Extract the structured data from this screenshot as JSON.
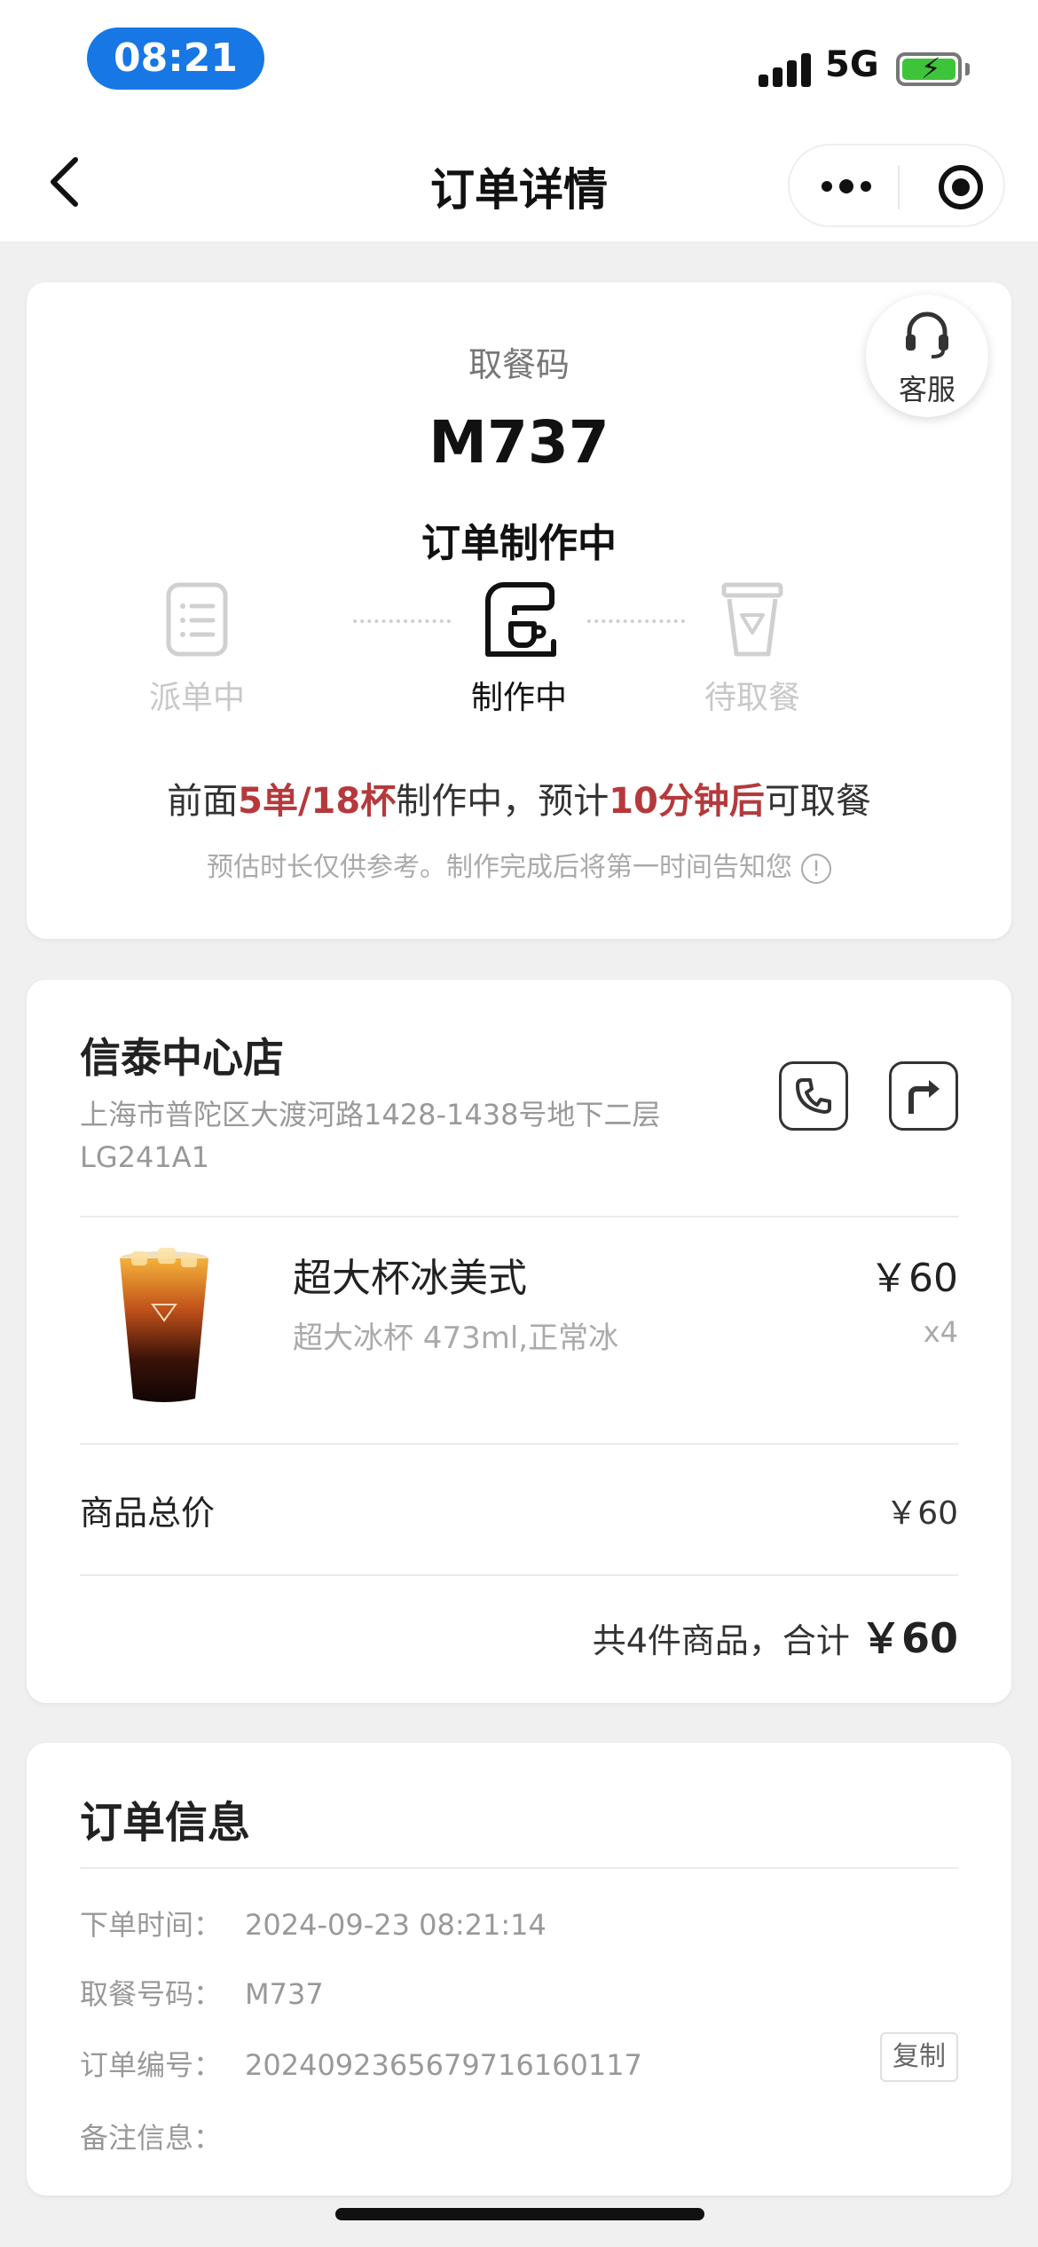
{
  "status_bar": {
    "time": "08:21",
    "network": "5G"
  },
  "nav": {
    "title": "订单详情"
  },
  "pickup": {
    "customer_service_label": "客服",
    "code_label": "取餐码",
    "code": "M737",
    "status": "订单制作中",
    "steps": [
      {
        "label": "派单中",
        "state": "done",
        "icon": "list-doc-icon"
      },
      {
        "label": "制作中",
        "state": "active",
        "icon": "coffee-machine-icon"
      },
      {
        "label": "待取餐",
        "state": "pending",
        "icon": "cup-icon"
      }
    ],
    "eta": {
      "prefix": "前面",
      "queue": "5单/18杯",
      "middle": "制作中，预计",
      "time": "10分钟后",
      "suffix": "可取餐"
    },
    "note": "预估时长仅供参考。制作完成后将第一时间告知您"
  },
  "store": {
    "name": "信泰中心店",
    "address": "上海市普陀区大渡河路1428-1438号地下二层LG241A1"
  },
  "product": {
    "name": "超大杯冰美式",
    "spec": "超大冰杯 473ml,正常冰",
    "price": "￥60",
    "qty": "x4"
  },
  "summary": {
    "subtotal_label": "商品总价",
    "subtotal_value": "￥60",
    "total_prefix": "共4件商品，合计",
    "total_amount": "￥60"
  },
  "order_info": {
    "title": "订单信息",
    "rows": [
      {
        "key": "下单时间：",
        "value": "2024-09-23 08:21:14"
      },
      {
        "key": "取餐号码：",
        "value": "M737"
      },
      {
        "key": "订单编号：",
        "value": "2024092365679716160117"
      },
      {
        "key": "备注信息：",
        "value": ""
      }
    ],
    "copy_label": "复制"
  },
  "colors": {
    "accent_red": "#b5393c",
    "time_pill": "#1677e5",
    "battery": "#3ec43a"
  }
}
